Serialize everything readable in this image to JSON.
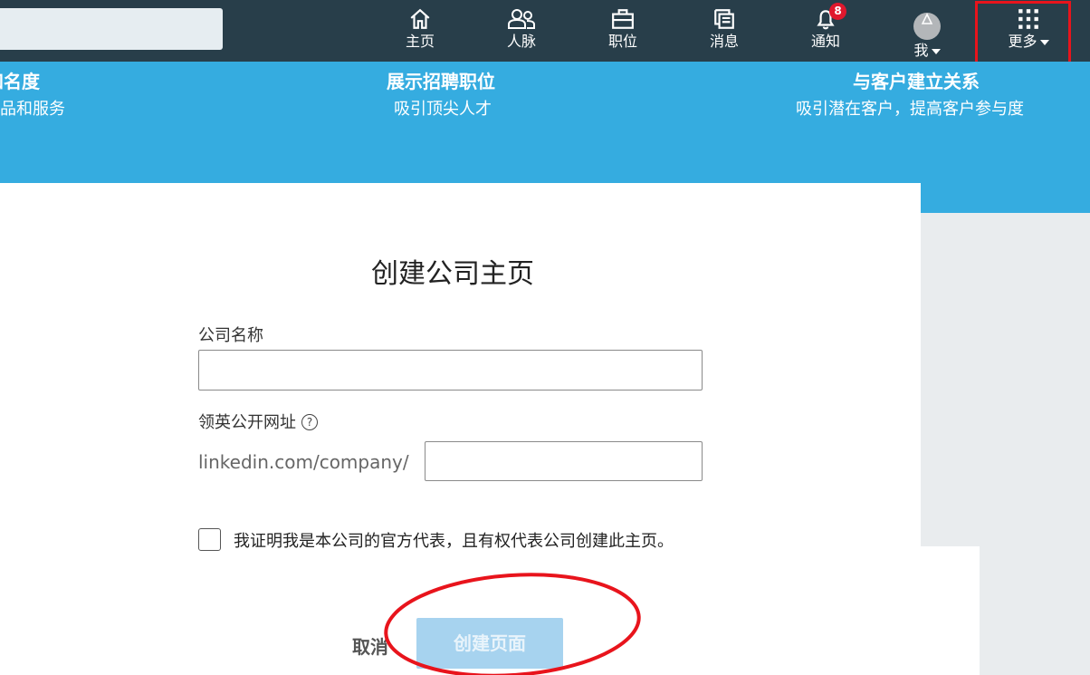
{
  "nav": {
    "items": [
      {
        "label": "主页",
        "icon": "home-icon"
      },
      {
        "label": "人脉",
        "icon": "people-icon"
      },
      {
        "label": "职位",
        "icon": "briefcase-icon"
      },
      {
        "label": "消息",
        "icon": "messages-icon"
      },
      {
        "label": "通知",
        "icon": "bell-icon",
        "badge": "8"
      },
      {
        "label": "我",
        "icon": "avatar"
      },
      {
        "label": "更多",
        "icon": "grid-icon"
      }
    ]
  },
  "banner": {
    "features": [
      {
        "title": "知名度",
        "subtitle": "产品和服务"
      },
      {
        "title": "展示招聘职位",
        "subtitle": "吸引顶尖人才"
      },
      {
        "title": "与客户建立关系",
        "subtitle": "吸引潜在客户，提高客户参与度"
      }
    ]
  },
  "modal": {
    "title": "创建公司主页",
    "company_name_label": "公司名称",
    "company_name_value": "",
    "url_label": "领英公开网址",
    "url_prefix": "linkedin.com/company/",
    "url_value": "",
    "certify_text": "我证明我是本公司的官方代表，且有权代表公司创建此主页。",
    "cancel_label": "取消",
    "create_label": "创建页面"
  },
  "colors": {
    "nav_bg": "#283e4a",
    "banner_bg": "#35ace0",
    "badge": "#e0182d",
    "create_disabled": "#a7d3ef",
    "annotation_red": "#e8141c"
  }
}
